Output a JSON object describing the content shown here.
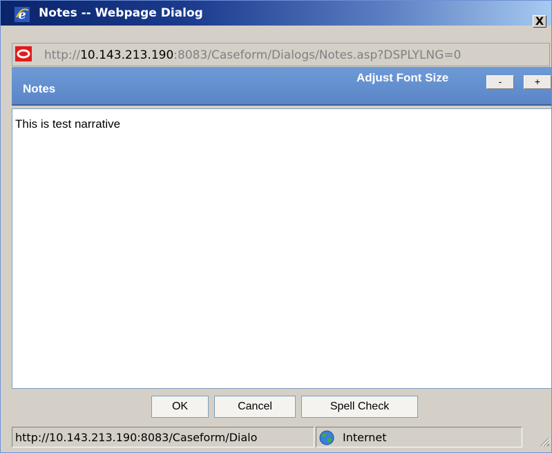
{
  "window": {
    "title": "Notes -- Webpage Dialog",
    "close_label": "X"
  },
  "address": {
    "prefix": "http://",
    "host": "10.143.213.190",
    "rest": ":8083/Caseform/Dialogs/Notes.asp?DSPLYLNG=0"
  },
  "header": {
    "title": "Notes",
    "adjust_label": "Adjust Font Size",
    "decrease_label": "-",
    "increase_label": "+"
  },
  "notes": {
    "text": "This is test narrative"
  },
  "buttons": {
    "ok": "OK",
    "cancel": "Cancel",
    "spell_check": "Spell Check"
  },
  "status": {
    "url": "http://10.143.213.190:8083/Caseform/Dialo",
    "zone": "Internet"
  },
  "colors": {
    "header_blue": "#5a86c8",
    "title_dark": "#0a246a"
  }
}
